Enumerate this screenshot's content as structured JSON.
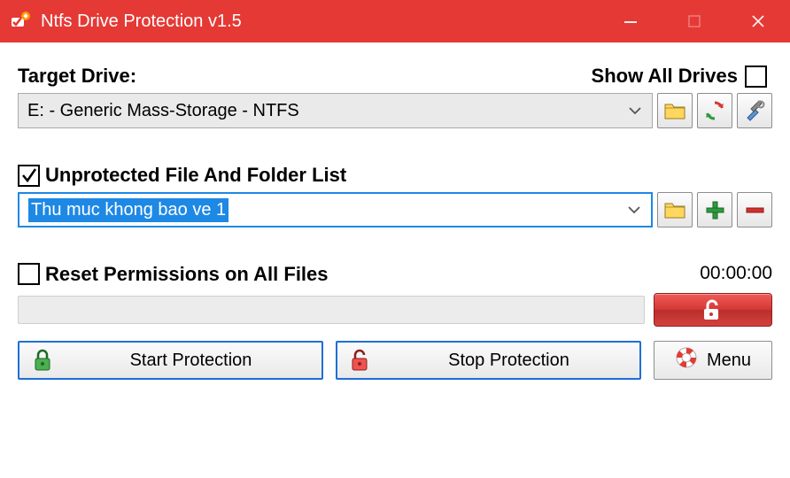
{
  "window": {
    "title": "Ntfs Drive Protection v1.5"
  },
  "labels": {
    "target_drive": "Target Drive:",
    "show_all_drives": "Show All Drives",
    "unprotected_list": "Unprotected File And Folder List",
    "reset_permissions": "Reset Permissions on All Files"
  },
  "drive": {
    "selected": "E: - Generic Mass-Storage - NTFS"
  },
  "unprotected": {
    "checked": true,
    "selected": "Thu muc khong bao ve 1"
  },
  "reset": {
    "checked": false
  },
  "timer": "00:00:00",
  "buttons": {
    "start": "Start Protection",
    "stop": "Stop Protection",
    "menu": "Menu"
  },
  "show_all_checked": false
}
